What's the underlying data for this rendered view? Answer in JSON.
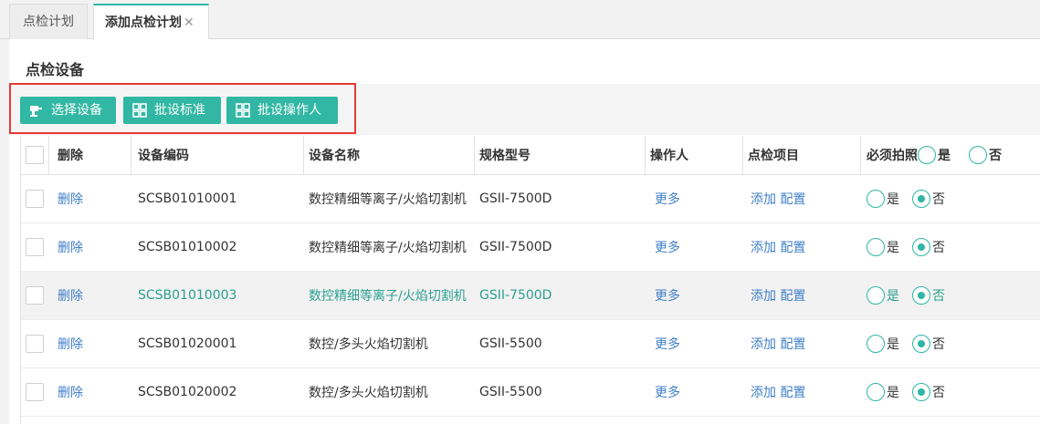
{
  "tabs": [
    {
      "label": "点检计划"
    },
    {
      "label": "添加点检计划",
      "close": "✕"
    }
  ],
  "section_title": "点检设备",
  "toolbar": {
    "select_device": "选择设备",
    "batch_standard": "批设标准",
    "batch_operator": "批设操作人"
  },
  "table": {
    "headers": {
      "delete": "删除",
      "code": "设备编码",
      "name": "设备名称",
      "spec": "规格型号",
      "operator": "操作人",
      "items": "点检项目",
      "photo": "必须拍照",
      "yes": "是",
      "no": "否"
    },
    "rows": [
      {
        "delete": "删除",
        "code": "SCSB01010001",
        "name": "数控精细等离子/火焰切割机",
        "spec": "GSII-7500D",
        "operator": "更多",
        "add": "添加",
        "config": "配置",
        "yes": "是",
        "no": "否"
      },
      {
        "delete": "删除",
        "code": "SCSB01010002",
        "name": "数控精细等离子/火焰切割机",
        "spec": "GSII-7500D",
        "operator": "更多",
        "add": "添加",
        "config": "配置",
        "yes": "是",
        "no": "否"
      },
      {
        "delete": "删除",
        "code": "SCSB01010003",
        "name": "数控精细等离子/火焰切割机",
        "spec": "GSII-7500D",
        "operator": "更多",
        "add": "添加",
        "config": "配置",
        "yes": "是",
        "no": "否"
      },
      {
        "delete": "删除",
        "code": "SCSB01020001",
        "name": "数控/多头火焰切割机",
        "spec": "GSII-5500",
        "operator": "更多",
        "add": "添加",
        "config": "配置",
        "yes": "是",
        "no": "否"
      },
      {
        "delete": "删除",
        "code": "SCSB01020002",
        "name": "数控/多头火焰切割机",
        "spec": "GSII-5500",
        "operator": "更多",
        "add": "添加",
        "config": "配置",
        "yes": "是",
        "no": "否"
      }
    ]
  },
  "colors": {
    "accent": "#31b7a3",
    "link": "#3f7fc9",
    "highlight_border": "#e53935"
  }
}
